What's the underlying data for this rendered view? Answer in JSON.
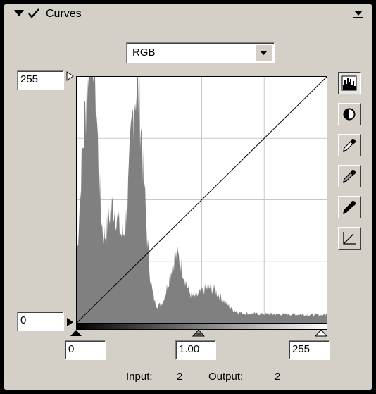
{
  "panel": {
    "title": "Curves"
  },
  "channel": {
    "selected": "RGB"
  },
  "output_levels": {
    "max": "255",
    "min": "0"
  },
  "input_levels": {
    "black": "0",
    "gamma": "1.00",
    "white": "255"
  },
  "readout": {
    "input_label": "Input:",
    "input_value": "2",
    "output_label": "Output:",
    "output_value": "2"
  },
  "tools": [
    {
      "name": "histogram-icon",
      "pressed": true
    },
    {
      "name": "auto-contrast-icon",
      "pressed": false
    },
    {
      "name": "white-eyedropper-icon",
      "pressed": false
    },
    {
      "name": "gray-eyedropper-icon",
      "pressed": false
    },
    {
      "name": "black-eyedropper-icon",
      "pressed": false
    },
    {
      "name": "reset-curve-icon",
      "pressed": false
    }
  ],
  "colors": {
    "panel": "#d4d0c8",
    "histogram": "#808080",
    "grid": "#c8c8c8",
    "curve": "#000000"
  }
}
